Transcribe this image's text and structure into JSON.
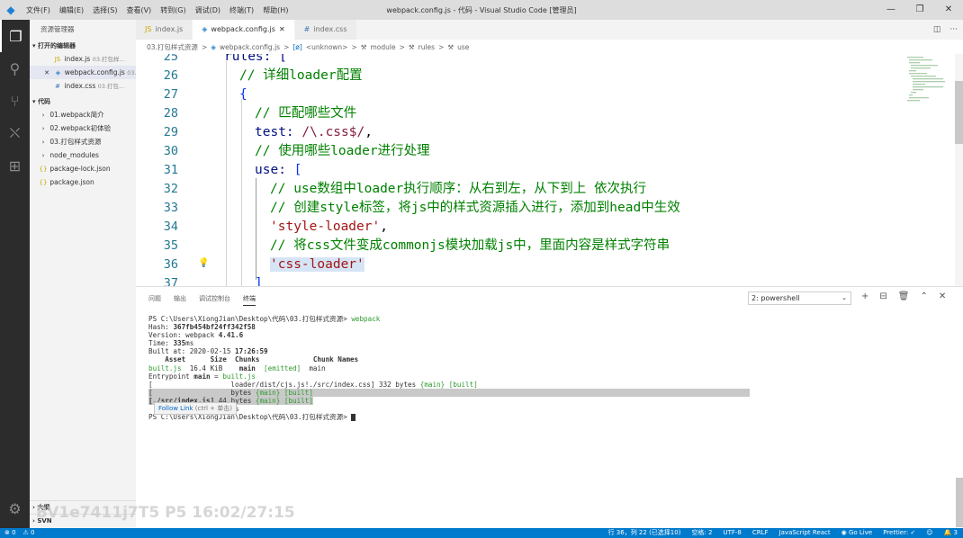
{
  "titlebar": {
    "menu": [
      "文件(F)",
      "编辑(E)",
      "选择(S)",
      "查看(V)",
      "转到(G)",
      "调试(D)",
      "终端(T)",
      "帮助(H)"
    ],
    "window_title": "webpack.config.js - 代码 - Visual Studio Code [管理员]"
  },
  "sidebar": {
    "title": "资源管理器",
    "open_editors_header": "打开的编辑器",
    "open_editors": [
      {
        "name": "index.js",
        "sub": "03.打包样..."
      },
      {
        "name": "webpack.config.js",
        "sub": "03..."
      },
      {
        "name": "index.css",
        "sub": "03.打包..."
      }
    ],
    "folder_header": "代码",
    "tree": [
      {
        "name": "01.webpack简介"
      },
      {
        "name": "02.webpack初体验"
      },
      {
        "name": "03.打包样式资源"
      },
      {
        "name": "node_modules"
      },
      {
        "name": "package-lock.json"
      },
      {
        "name": "package.json"
      }
    ],
    "outline_header": "大纲",
    "svn_header": "SVN"
  },
  "tabs": [
    {
      "label": "index.js",
      "icon": "js"
    },
    {
      "label": "webpack.config.js",
      "icon": "webpack"
    },
    {
      "label": "index.css",
      "icon": "css"
    }
  ],
  "breadcrumb": {
    "parts": [
      "03.打包样式资源",
      "webpack.config.js",
      "<unknown>",
      "module",
      "rules",
      "use"
    ],
    "sep": ">"
  },
  "editor": {
    "lines": [
      {
        "no": "25",
        "indent": 0,
        "tokens": [
          {
            "t": "rules: [",
            "c": "prop"
          }
        ]
      },
      {
        "no": "26",
        "indent": 1,
        "tokens": [
          {
            "t": "// 详细loader配置",
            "c": "cm"
          }
        ]
      },
      {
        "no": "27",
        "indent": 1,
        "tokens": [
          {
            "t": "{",
            "c": "brk"
          }
        ]
      },
      {
        "no": "28",
        "indent": 2,
        "tokens": [
          {
            "t": "// 匹配哪些文件",
            "c": "cm"
          }
        ]
      },
      {
        "no": "29",
        "indent": 2,
        "tokens": [
          {
            "t": "test: ",
            "c": "prop"
          },
          {
            "t": "/\\.css$/",
            "c": "rx"
          },
          {
            "t": ",",
            "c": "plain"
          }
        ]
      },
      {
        "no": "30",
        "indent": 2,
        "tokens": [
          {
            "t": "// 使用哪些loader进行处理",
            "c": "cm"
          }
        ]
      },
      {
        "no": "31",
        "indent": 2,
        "tokens": [
          {
            "t": "use: ",
            "c": "prop"
          },
          {
            "t": "[",
            "c": "brk"
          }
        ]
      },
      {
        "no": "32",
        "indent": 3,
        "tokens": [
          {
            "t": "// use数组中loader执行顺序：从右到左，从下到上 依次执行",
            "c": "cm"
          }
        ]
      },
      {
        "no": "33",
        "indent": 3,
        "tokens": [
          {
            "t": "// 创建style标签，将js中的样式资源插入进行，添加到head中生效",
            "c": "cm"
          }
        ]
      },
      {
        "no": "34",
        "indent": 3,
        "tokens": [
          {
            "t": "'style-loader'",
            "c": "str"
          },
          {
            "t": ",",
            "c": "plain"
          }
        ]
      },
      {
        "no": "35",
        "indent": 3,
        "tokens": [
          {
            "t": "// 将css文件变成commonjs模块加载js中，里面内容是样式字符串",
            "c": "cm"
          }
        ]
      },
      {
        "no": "36",
        "indent": 3,
        "tokens": [
          {
            "t": "'css-loader'",
            "c": "str"
          }
        ],
        "bulb": true
      },
      {
        "no": "37",
        "indent": 2,
        "tokens": [
          {
            "t": "]",
            "c": "brk"
          }
        ]
      }
    ]
  },
  "panel": {
    "tabs": [
      "问题",
      "输出",
      "调试控制台",
      "终端"
    ],
    "active_tab": "终端",
    "terminal_select": "2: powershell",
    "actions": [
      "+",
      "⊟",
      "🗑",
      "⌃",
      "✕"
    ],
    "terminal_lines": [
      [
        {
          "t": "PS C:\\Users\\XiongJian\\Desktop\\代码\\03.打包样式资源> "
        },
        {
          "t": "webpack",
          "c": "tg"
        }
      ],
      [
        {
          "t": "Hash: "
        },
        {
          "t": "367fb454bf24ff342f58",
          "c": "bold"
        }
      ],
      [
        {
          "t": "Version: webpack "
        },
        {
          "t": "4.41.6",
          "c": "bold"
        }
      ],
      [
        {
          "t": "Time: "
        },
        {
          "t": "335",
          "c": "bold"
        },
        {
          "t": "ms"
        }
      ],
      [
        {
          "t": "Built at: 2020-02-15 "
        },
        {
          "t": "17:26:59",
          "c": "bold"
        }
      ],
      [
        {
          "t": "    Asset      Size  Chunks             Chunk Names",
          "c": "bold"
        }
      ],
      [
        {
          "t": "built.js",
          "c": "tg"
        },
        {
          "t": "  16.4 KiB    "
        },
        {
          "t": "main",
          "c": "bold"
        },
        {
          "t": "  "
        },
        {
          "t": "[emitted]",
          "c": "tg"
        },
        {
          "t": "  main"
        }
      ],
      [
        {
          "t": "Entrypoint "
        },
        {
          "t": "main",
          "c": "bold"
        },
        {
          "t": " = "
        },
        {
          "t": "built.js",
          "c": "tg"
        }
      ],
      [
        {
          "t": "[                   loader/dist/cjs.js!./src/index.css] 332 bytes "
        },
        {
          "t": "{main}",
          "c": "tg"
        },
        {
          "t": " "
        },
        {
          "t": "[built]",
          "c": "tg"
        }
      ],
      [
        {
          "t": "[                   bytes ",
          "c": "hl"
        },
        {
          "t": "{main}",
          "c": "tg hl"
        },
        {
          "t": " ",
          "c": "hl"
        },
        {
          "t": "[built]",
          "c": "tg hl"
        },
        {
          "t": "                                                                                                          ",
          "c": "hl"
        }
      ],
      [
        {
          "t": "[./src/index.js]",
          "c": "bold hl"
        },
        {
          "t": " 44 bytes ",
          "c": "hl"
        },
        {
          "t": "{main}",
          "c": "tg hl"
        },
        {
          "t": " ",
          "c": "hl"
        },
        {
          "t": "[built]",
          "c": "tg hl"
        }
      ],
      [
        {
          "t": "    + 2 hidden modules"
        }
      ],
      [
        {
          "t": "PS C:\\Users\\XiongJian\\Desktop\\代码\\03.打包样式资源> "
        }
      ]
    ],
    "follow_link": {
      "label": "Follow Link",
      "hint": "(ctrl + 单击)"
    }
  },
  "watermark": "BV1e7411j7T5 P5 16:02/27:15",
  "statusbar": {
    "left": [
      "⊗ 0",
      "⚠ 0"
    ],
    "right": [
      "行 36，列 22 (已选择10)",
      "空格: 2",
      "UTF-8",
      "CRLF",
      "JavaScript React",
      "◉ Go Live",
      "Prettier: ✓",
      "☺",
      "🔔 3"
    ]
  }
}
